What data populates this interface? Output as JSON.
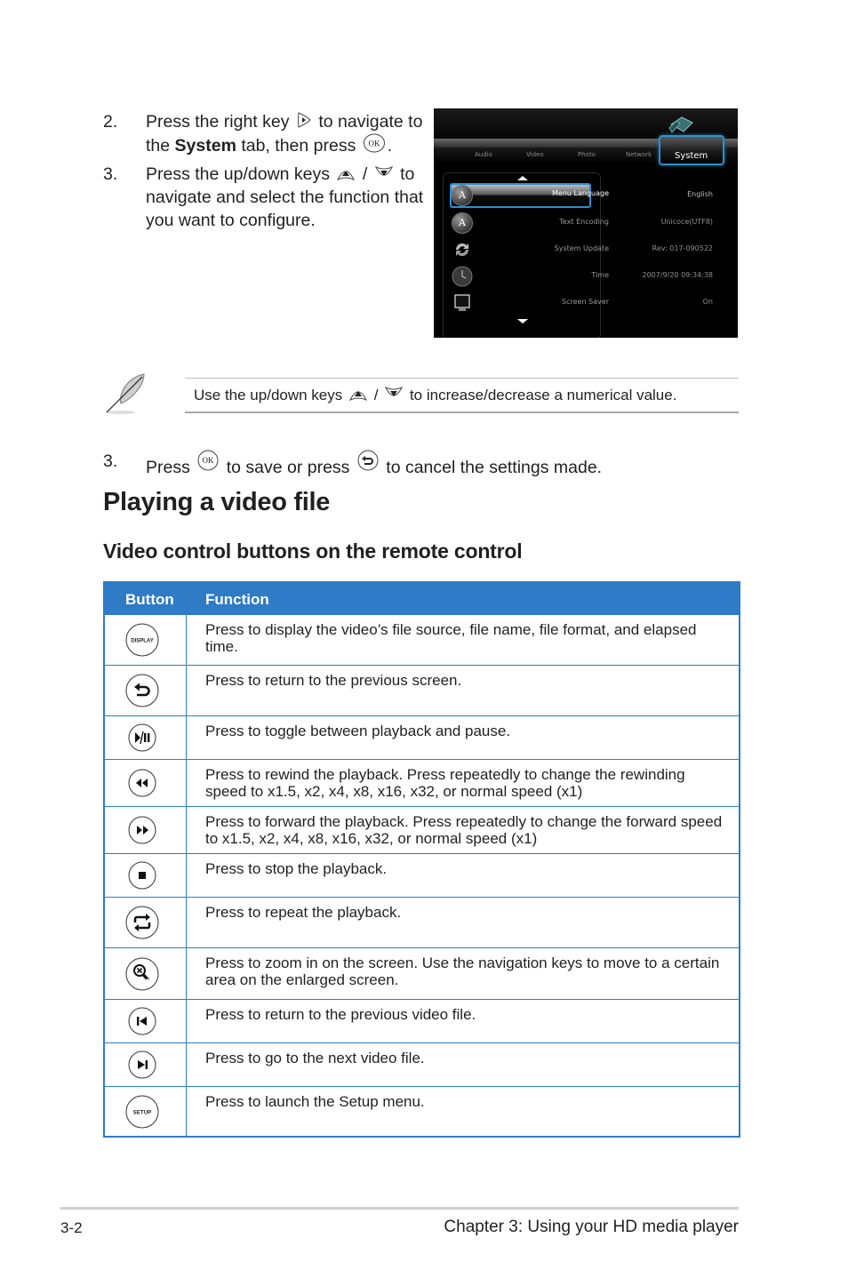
{
  "steps_top": [
    {
      "number": "2.",
      "line1_a": "Press the right key",
      "line1_b": "to navigate to",
      "line2_a": "the",
      "line2_bold": "System",
      "line2_b": "tab, then press",
      "line2_end": "."
    },
    {
      "number": "3.",
      "line1_a": "Press the up/down keys",
      "line1_sep": "/",
      "line1_b": "to",
      "line2": "navigate and select the function that",
      "line3": "you want to configure."
    }
  ],
  "screenshot": {
    "tabs": [
      "Audio",
      "Video",
      "Photo",
      "Network"
    ],
    "active_tab": "System",
    "rows": [
      {
        "label": "Menu Language",
        "value": "English",
        "icon": "language-icon",
        "selected": true
      },
      {
        "label": "Text Encoding",
        "value": "Unicoce(UTF8)",
        "icon": "language-icon",
        "selected": false
      },
      {
        "label": "System Update",
        "value": "Rev: 017-090522",
        "icon": "refresh-icon",
        "selected": false
      },
      {
        "label": "Time",
        "value": "2007/9/20 09:34:38",
        "icon": "clock-icon",
        "selected": false
      },
      {
        "label": "Screen Saver",
        "value": "On",
        "icon": "monitor-icon",
        "selected": false
      }
    ]
  },
  "note": {
    "text_a": "Use the up/down keys",
    "sep": "/",
    "text_b": "to increase/decrease a numerical value."
  },
  "step_save": {
    "number": "3.",
    "a": "Press",
    "b": "to save or press",
    "c": "to cancel the settings made."
  },
  "heading": "Playing a video file",
  "subheading": "Video control buttons on the remote control",
  "table": {
    "header": {
      "button": "Button",
      "function": "Function"
    },
    "accent_color": "#2f7bc7",
    "rows": [
      {
        "icon": "display-button-icon",
        "icon_text": "DISPLAY",
        "function": "Press to display the video’s file source, file name, file format, and elapsed time."
      },
      {
        "icon": "back-button-icon",
        "icon_text": "",
        "function": "Press to return to the previous screen."
      },
      {
        "icon": "play-pause-button-icon",
        "icon_text": "",
        "function": "Press to toggle between playback and pause."
      },
      {
        "icon": "rewind-button-icon",
        "icon_text": "",
        "function": "Press to rewind the playback. Press repeatedly to change the rewinding speed to x1.5, x2, x4, x8, x16, x32, or normal speed (x1)"
      },
      {
        "icon": "fast-forward-button-icon",
        "icon_text": "",
        "function": "Press to forward the playback. Press repeatedly to change the forward speed to x1.5, x2, x4, x8, x16, x32, or normal speed (x1)"
      },
      {
        "icon": "stop-button-icon",
        "icon_text": "",
        "function": "Press to stop the playback."
      },
      {
        "icon": "repeat-button-icon",
        "icon_text": "",
        "function": "Press to repeat the playback."
      },
      {
        "icon": "zoom-button-icon",
        "icon_text": "",
        "function": "Press to zoom in on the screen. Use the navigation keys to move to a certain area on the enlarged screen."
      },
      {
        "icon": "previous-button-icon",
        "icon_text": "",
        "function": "Press to return to the previous video file."
      },
      {
        "icon": "next-button-icon",
        "icon_text": "",
        "function": "Press to go to the next video file."
      },
      {
        "icon": "setup-button-icon",
        "icon_text": "SETUP",
        "function": "Press to launch the Setup menu."
      }
    ]
  },
  "footer": {
    "page_number": "3-2",
    "chapter": "Chapter 3: Using your HD media player"
  }
}
